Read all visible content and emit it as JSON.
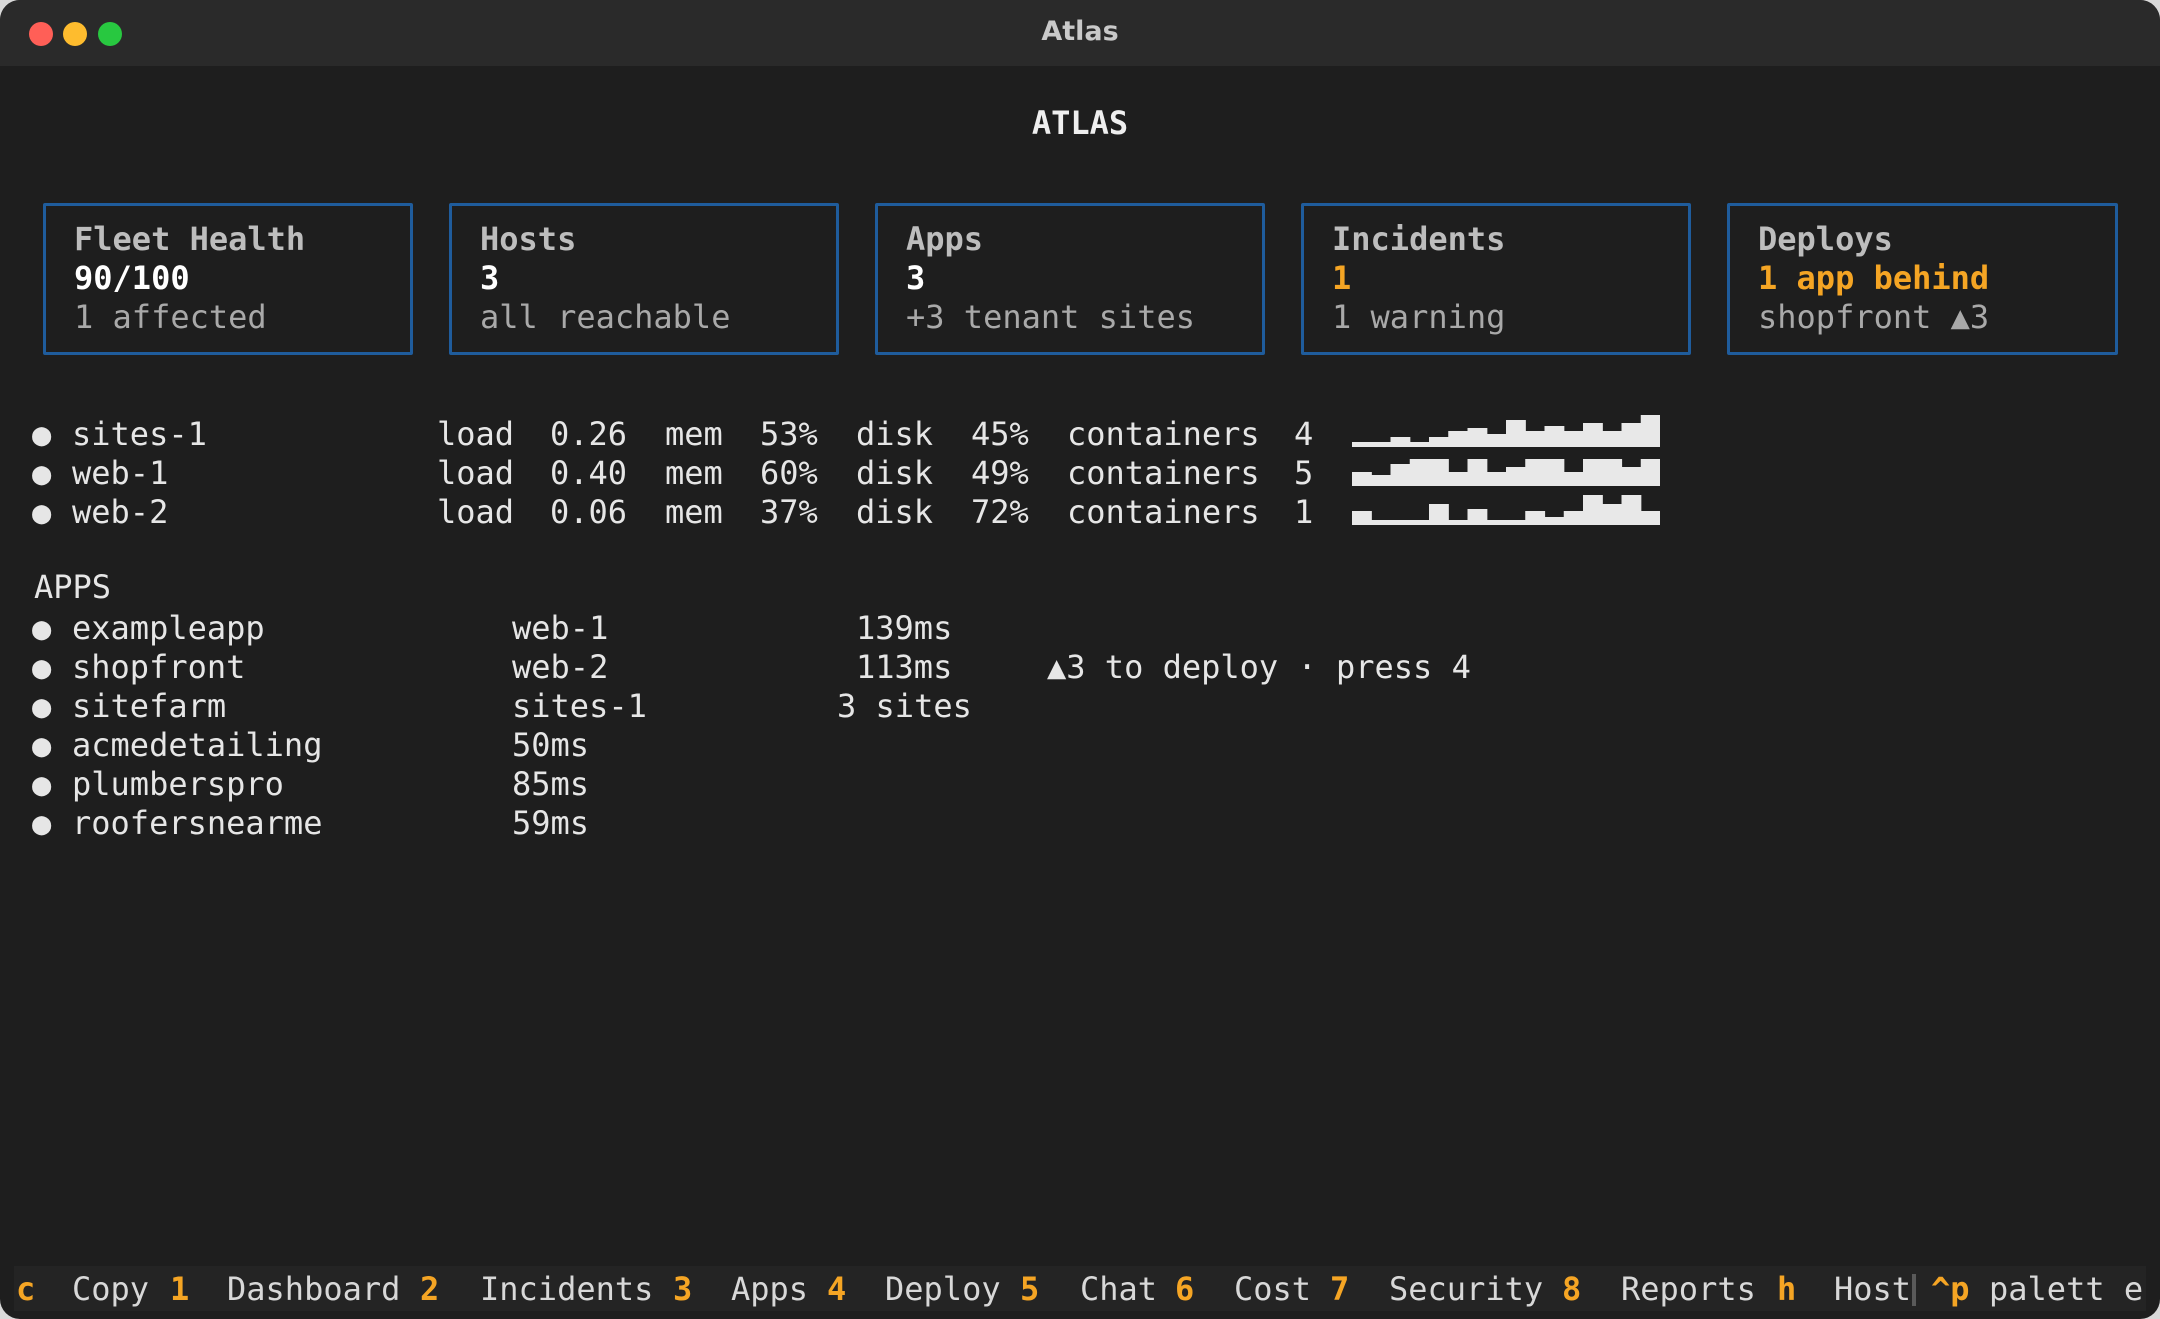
{
  "window": {
    "title": "Atlas"
  },
  "header": {
    "title": "ATLAS"
  },
  "cards": [
    {
      "title": "Fleet Health",
      "value": "90/100",
      "sub": "1 affected"
    },
    {
      "title": "Hosts",
      "value": "3",
      "sub": "all reachable"
    },
    {
      "title": "Apps",
      "value": "3",
      "sub": "+3 tenant sites"
    },
    {
      "title": "Incidents",
      "value": "1",
      "sub": "1 warning",
      "value_color": "#f5a524"
    },
    {
      "title": "Deploys",
      "value": "1 app behind",
      "sub": "shopfront ▲3",
      "value_color": "#f5a524"
    }
  ],
  "hosts": {
    "labels": {
      "load": "load",
      "mem": "mem",
      "disk": "disk",
      "containers": "containers"
    },
    "rows": [
      {
        "name": "sites-1",
        "load": "0.26",
        "mem": "53%",
        "disk": "45%",
        "containers": "4",
        "history": [
          0.15,
          0.15,
          0.3,
          0.15,
          0.3,
          0.5,
          0.6,
          0.4,
          0.85,
          0.5,
          0.65,
          0.5,
          0.75,
          0.5,
          0.75,
          1.0
        ]
      },
      {
        "name": "web-1",
        "load": "0.40",
        "mem": "60%",
        "disk": "49%",
        "containers": "5",
        "history": [
          0.45,
          0.35,
          0.7,
          0.85,
          0.85,
          0.45,
          0.85,
          0.45,
          0.6,
          0.85,
          0.85,
          0.45,
          0.85,
          0.85,
          0.6,
          0.85
        ]
      },
      {
        "name": "web-2",
        "load": "0.06",
        "mem": "37%",
        "disk": "72%",
        "containers": "1",
        "history": [
          0.45,
          0.15,
          0.15,
          0.15,
          0.65,
          0.15,
          0.5,
          0.15,
          0.15,
          0.45,
          0.25,
          0.45,
          0.95,
          0.65,
          0.95,
          0.45
        ]
      }
    ],
    "colors": {
      "sparkline": "#e8e8e8"
    }
  },
  "apps": {
    "label": "APPS",
    "rows": [
      {
        "name": "exampleapp",
        "host": "web-1",
        "latency": "139ms",
        "note": ""
      },
      {
        "name": "shopfront",
        "host": "web-2",
        "latency": "113ms",
        "note": "▲3 to deploy · press 4"
      },
      {
        "name": "sitefarm",
        "host": "sites-1",
        "latency": "3 sites",
        "note": ""
      },
      {
        "name": "acmedetailing",
        "host": "50ms",
        "latency": "",
        "note": ""
      },
      {
        "name": "plumberspro",
        "host": "85ms",
        "latency": "",
        "note": ""
      },
      {
        "name": "roofersnearme",
        "host": "59ms",
        "latency": "",
        "note": ""
      }
    ]
  },
  "footer": {
    "items": [
      {
        "key": "c",
        "label": "Copy"
      },
      {
        "key": "1",
        "label": "Dashboard"
      },
      {
        "key": "2",
        "label": "Incidents"
      },
      {
        "key": "3",
        "label": "Apps"
      },
      {
        "key": "4",
        "label": "Deploy"
      },
      {
        "key": "5",
        "label": "Chat"
      },
      {
        "key": "6",
        "label": "Cost"
      },
      {
        "key": "7",
        "label": "Security"
      },
      {
        "key": "8",
        "label": "Reports"
      },
      {
        "key": "h",
        "label": "Host"
      },
      {
        "key": "^p",
        "label": "palett e"
      }
    ]
  }
}
